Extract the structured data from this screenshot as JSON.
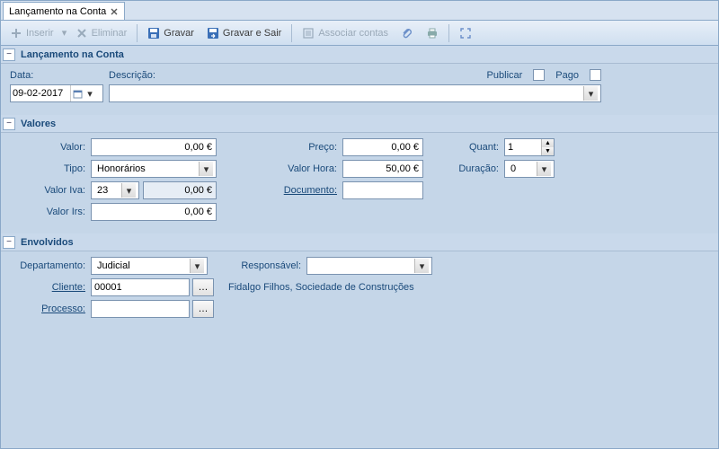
{
  "tab": {
    "title": "Lançamento na Conta"
  },
  "toolbar": {
    "inserir": "Inserir",
    "eliminar": "Eliminar",
    "gravar": "Gravar",
    "gravar_sair": "Gravar e Sair",
    "associar": "Associar contas"
  },
  "sections": {
    "lancamento": "Lançamento na Conta",
    "valores": "Valores",
    "envolvidos": "Envolvidos"
  },
  "lancamento": {
    "data_label": "Data:",
    "data_value": "09-02-2017",
    "descricao_label": "Descrição:",
    "descricao_value": "",
    "publicar_label": "Publicar",
    "pago_label": "Pago"
  },
  "valores": {
    "valor_label": "Valor:",
    "valor_value": "0,00 €",
    "tipo_label": "Tipo:",
    "tipo_value": "Honorários",
    "valor_iva_label": "Valor Iva:",
    "iva_rate": "23",
    "iva_value": "0,00 €",
    "valor_irs_label": "Valor Irs:",
    "irs_value": "0,00 €",
    "preco_label": "Preço:",
    "preco_value": "0,00 €",
    "valor_hora_label": "Valor Hora:",
    "valor_hora_value": "50,00 €",
    "documento_label": "Documento:",
    "documento_value": "",
    "quant_label": "Quant:",
    "quant_value": "1",
    "duracao_label": "Duração:",
    "duracao_value": "0"
  },
  "envolvidos": {
    "departamento_label": "Departamento:",
    "departamento_value": "Judicial",
    "responsavel_label": "Responsável:",
    "responsavel_value": "",
    "cliente_label": "Cliente:",
    "cliente_value": "00001",
    "cliente_name": "Fidalgo Filhos, Sociedade de Construções",
    "processo_label": "Processo:",
    "processo_value": ""
  }
}
